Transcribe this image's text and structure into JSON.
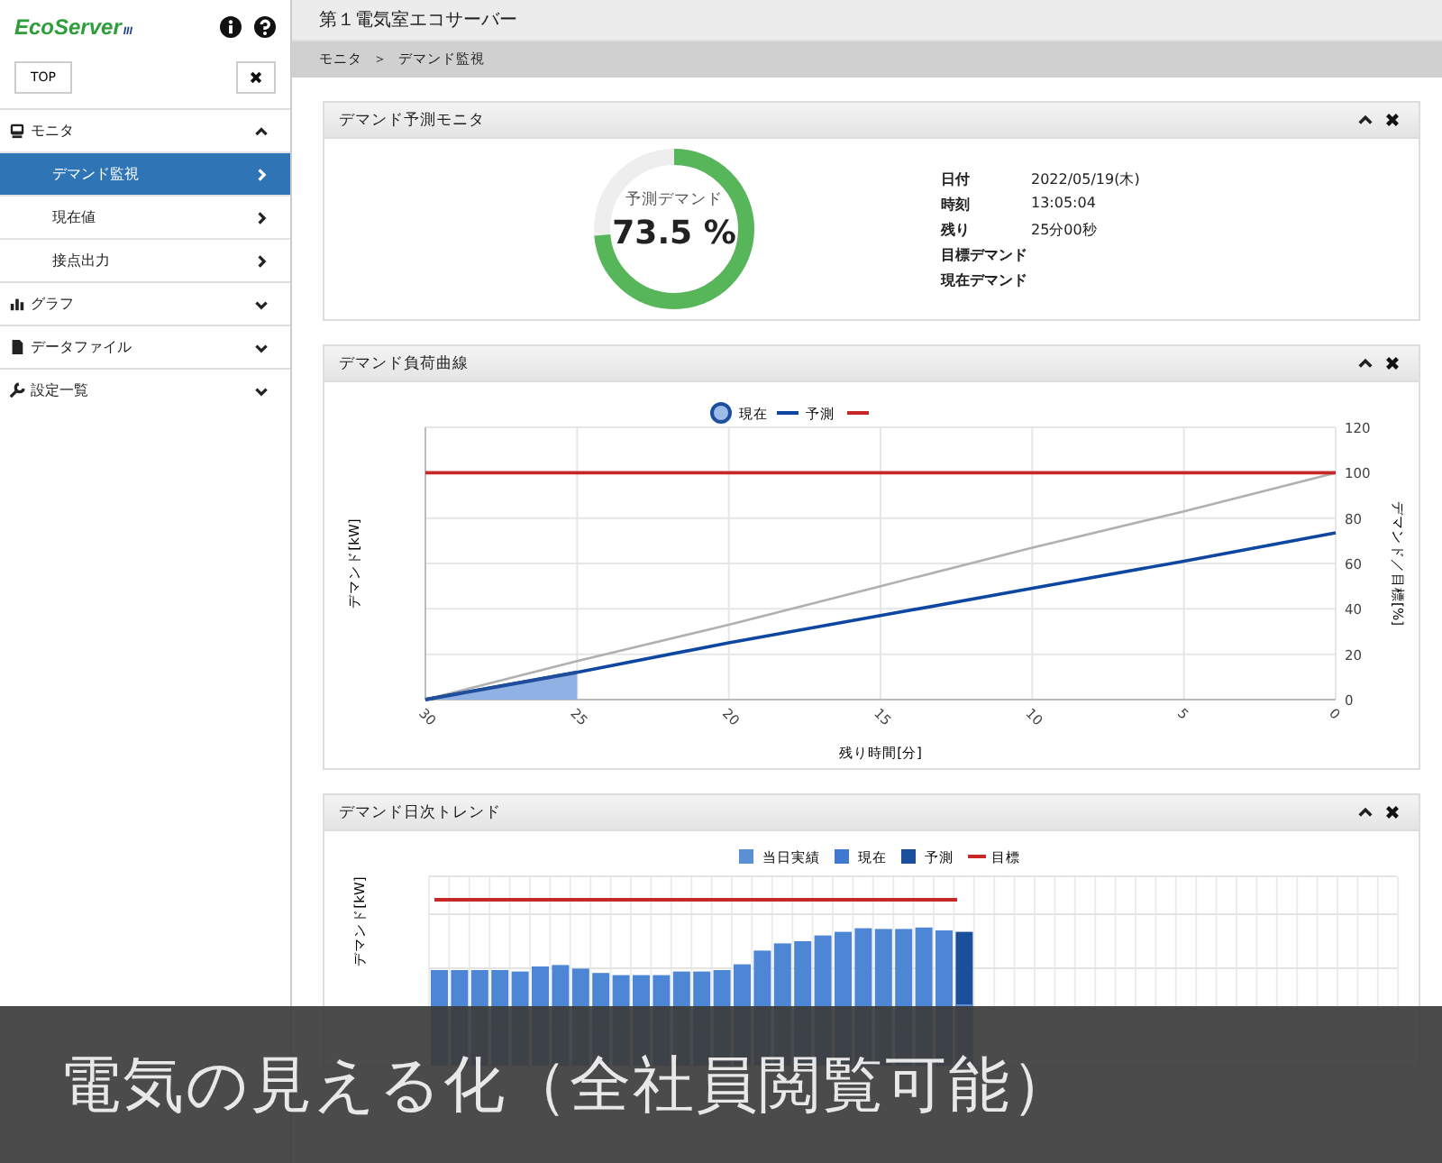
{
  "logo": {
    "text": "EcoServer",
    "suffix": "III"
  },
  "top_button": "TOP",
  "sidebar": {
    "items": [
      {
        "label": "モニタ",
        "expanded": true,
        "children": [
          {
            "label": "デマンド監視",
            "selected": true
          },
          {
            "label": "現在値",
            "selected": false
          },
          {
            "label": "接点出力",
            "selected": false
          }
        ]
      },
      {
        "label": "グラフ",
        "expanded": false
      },
      {
        "label": "データファイル",
        "expanded": false
      },
      {
        "label": "設定一覧",
        "expanded": false
      }
    ]
  },
  "page_title": "第１電気室エコサーバー",
  "breadcrumb": [
    "モニタ",
    "＞",
    "デマンド監視"
  ],
  "monitor_panel": {
    "title": "デマンド予測モニタ",
    "gauge": {
      "label": "予測デマンド",
      "value": "73.5 %",
      "level": 0.735
    },
    "info": [
      {
        "label": "日付",
        "value": "2022/05/19(木)"
      },
      {
        "label": "時刻",
        "value": "13:05:04"
      },
      {
        "label": "残り",
        "value": "25分00秒"
      },
      {
        "label": "目標デマンド"
      },
      {
        "label": "現在デマンド"
      }
    ]
  },
  "curve_panel": {
    "title": "デマンド負荷曲線",
    "y2label": "デマンド／目標[%]",
    "chart_data": {
      "type": "line",
      "xlabel": "残り時間[分]",
      "ylabel": "デマンド[kW]",
      "x": [
        30,
        25,
        20,
        15,
        10,
        5,
        0
      ],
      "grid": true,
      "legend": "top",
      "xlim": [
        30,
        0
      ],
      "ylim": [
        0,
        120
      ],
      "xticks": [
        30,
        25,
        20,
        15,
        10,
        5,
        0
      ],
      "yticks": [
        0,
        20,
        40,
        60,
        80,
        100,
        120
      ],
      "series": [
        {
          "name": "現在",
          "color": "#1f4e9c",
          "values": [
            0,
            12,
            null,
            null,
            null,
            null,
            null
          ]
        },
        {
          "name": "予測",
          "color": "#0d47a1",
          "values": [
            0,
            12,
            25,
            37,
            49,
            61,
            73.5
          ]
        },
        {
          "color": "#c62828",
          "values": [
            100,
            100,
            100,
            100,
            100,
            100,
            100
          ]
        },
        {
          "color": "#b0b0b0",
          "values": [
            0,
            17,
            33,
            50,
            67,
            83,
            100
          ]
        }
      ]
    }
  },
  "trend_panel": {
    "title": "デマンド日次トレンド",
    "ylabel": "デマンド[kW]",
    "legend": [
      {
        "label": "当日実績",
        "kind": "box",
        "color": "#5b8fd6"
      },
      {
        "label": "現在",
        "kind": "box",
        "color": "#3f7ad0"
      },
      {
        "label": "予測",
        "kind": "box",
        "color": "#1b4f9c"
      },
      {
        "label": "目標",
        "kind": "line",
        "color": "#c62828"
      }
    ]
  },
  "caption": "電気の見える化（全社員閲覧可能）"
}
